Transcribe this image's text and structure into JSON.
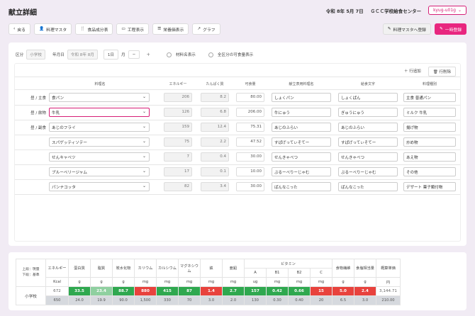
{
  "page": {
    "title": "献立詳細",
    "date": "令和 8年 5月 7日",
    "center": "ＧＣＣ学校給食センター",
    "user": "kyug-u01g"
  },
  "toolbar": {
    "back": "戻る",
    "master": "料理マスタ",
    "ingredients": "食品成分表",
    "process": "工程表示",
    "nutrient": "栄養価表示",
    "graph": "グラフ",
    "register_master": "料理マスタへ登録",
    "bulk_register": "一時登録"
  },
  "filter": {
    "kubun_label": "区分",
    "kubun_value": "小学校",
    "date_label": "年月日",
    "date_value": "令和 8年 8月",
    "day_value": "1日",
    "month_label": "月",
    "minus": "−",
    "plus": "＋",
    "opt1": "材料名表示",
    "opt2": "全区分の可食量表示"
  },
  "table": {
    "add_row": "＋ 行追加",
    "delete_row": "行削除",
    "headers": [
      "料理名",
      "エネルギー",
      "たんぱく質",
      "可食量",
      "献立表用料理名",
      "給食文字",
      "料理種別"
    ],
    "rows": [
      {
        "label": "昼 / 主食",
        "dish": "食パン",
        "energy": "206",
        "protein": "8.2",
        "amount": "80.00",
        "menu_name": "しょくパン",
        "kana": "しょくぱん",
        "type": "主食 普通パン",
        "active": false
      },
      {
        "label": "昼 / 飲物",
        "dish": "牛乳",
        "energy": "126",
        "protein": "6.8",
        "amount": "206.00",
        "menu_name": "牛にゅう",
        "kana": "ぎゅうにゅう",
        "type": "ミルク 牛乳",
        "active": true
      },
      {
        "label": "昼 / 副食",
        "dish": "あじのフライ",
        "energy": "159",
        "protein": "12.4",
        "amount": "75.31",
        "menu_name": "あじのふらい",
        "kana": "あじのふらい",
        "type": "揚げ物",
        "active": false
      },
      {
        "label": "",
        "dish": "スパゲッティソテー",
        "energy": "75",
        "protein": "2.2",
        "amount": "47.52",
        "menu_name": "すぱげってぃそてー",
        "kana": "すぱげってぃそてー",
        "type": "炒め物",
        "active": false
      },
      {
        "label": "",
        "dish": "せんキャベツ",
        "energy": "7",
        "protein": "0.4",
        "amount": "30.00",
        "menu_name": "せんきゃべつ",
        "kana": "せんきゃべつ",
        "type": "あえ物",
        "active": false
      },
      {
        "label": "",
        "dish": "ブルーベリージャム",
        "energy": "17",
        "protein": "0.1",
        "amount": "10.00",
        "menu_name": "ぶるーべりーじゃむ",
        "kana": "ぶるーべりーじゃむ",
        "type": "その他",
        "active": false
      },
      {
        "label": "",
        "dish": "パンナコッタ",
        "energy": "82",
        "protein": "3.4",
        "amount": "30.00",
        "menu_name": "ぱんなこった",
        "kana": "ぱんなこった",
        "type": "デザート 菓子類付物",
        "active": false
      }
    ]
  },
  "nutrition": {
    "legend_top": "上段：現量",
    "legend_bottom": "下段：基準",
    "row_label": "小学校",
    "vitamin": "ビタミン",
    "cols": [
      "エネルギー",
      "蛋白質",
      "脂質",
      "炭水化物",
      "カリウム",
      "カルシウム",
      "マグネシウム",
      "鉄",
      "亜鉛",
      "A",
      "B1",
      "B2",
      "C",
      "食物繊維",
      "食塩相当量",
      "概算単価"
    ],
    "units": [
      "Kcal",
      "g",
      "g",
      "g",
      "mg",
      "mg",
      "mg",
      "mg",
      "mg",
      "ug",
      "mg",
      "mg",
      "mg",
      "g",
      "g",
      "円"
    ],
    "values": [
      "672",
      "33.5",
      "23.4",
      "88.7",
      "880",
      "415",
      "87",
      "1.4",
      "2.7",
      "157",
      "0.42",
      "0.66",
      "15",
      "5.0",
      "2.4",
      "3,144.71"
    ],
    "standards": [
      "650",
      "24.0",
      "19.9",
      "90.0",
      "1,500",
      "330",
      "70",
      "3.0",
      "2.0",
      "130",
      "0.30",
      "0.40",
      "20",
      "6.5",
      "3.0",
      "210.00"
    ]
  },
  "colors": {
    "accent": "#e8267f",
    "ok": "#2fa84f",
    "over_light": "#8fd0a0",
    "bad": "#e8423d"
  }
}
